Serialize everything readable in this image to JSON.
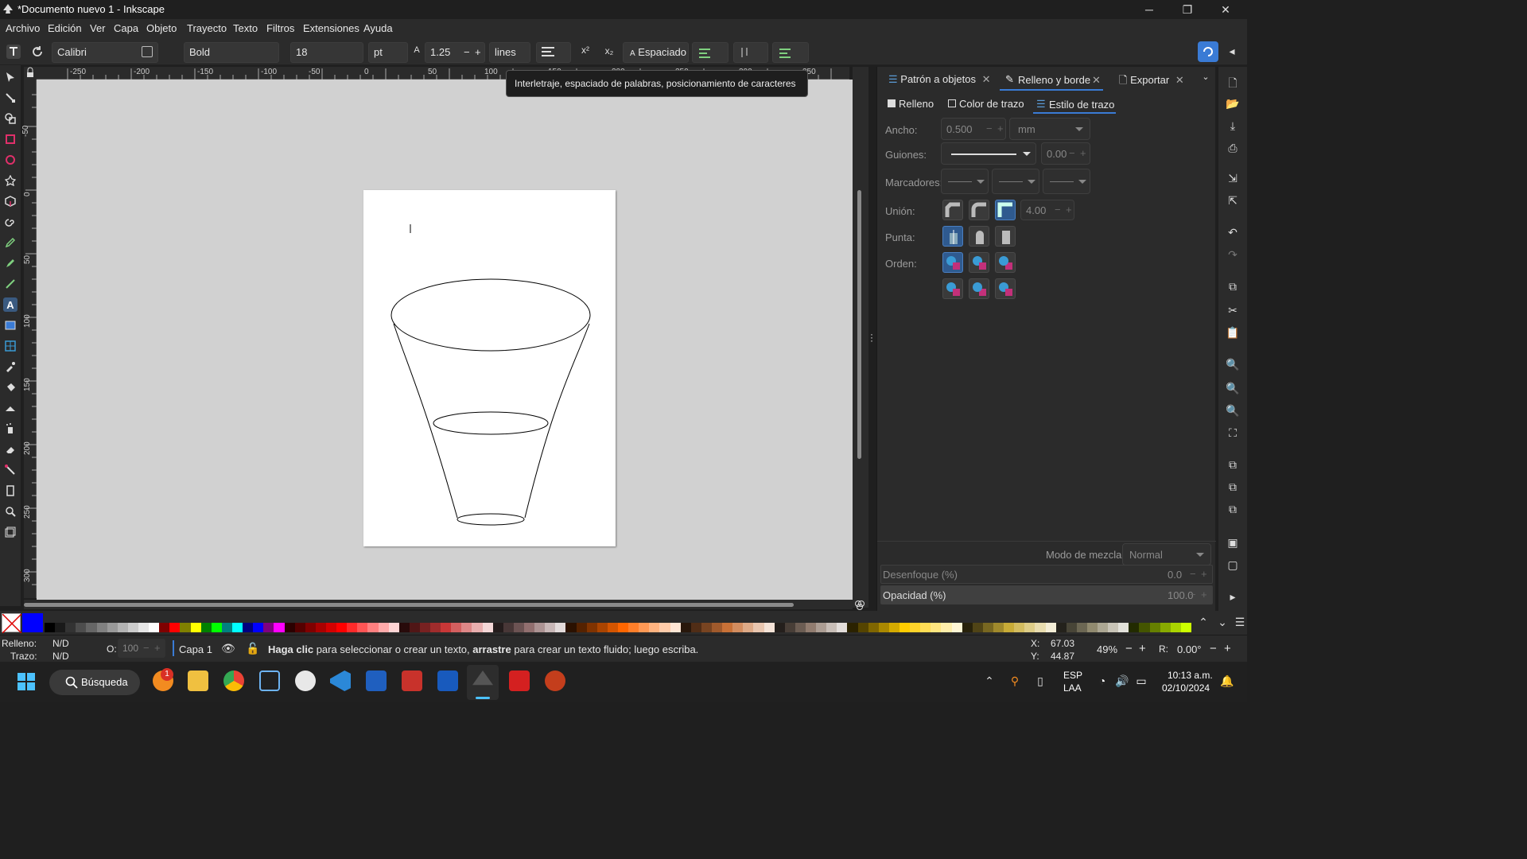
{
  "window": {
    "title": "*Documento nuevo 1 - Inkscape",
    "minimize": "─",
    "maximize": "❐",
    "close": "✕"
  },
  "menu": [
    "Archivo",
    "Edición",
    "Ver",
    "Capa",
    "Objeto",
    "Trayecto",
    "Texto",
    "Filtros",
    "Extensiones",
    "Ayuda"
  ],
  "toolbar": {
    "font_family": "Calibri",
    "font_style": "Bold",
    "font_size": "18",
    "unit": "pt",
    "line_height": "1.25",
    "line_unit": "lines",
    "spacing_label": "Espaciado",
    "minus": "−",
    "plus": "+"
  },
  "tooltip": "Interletraje, espaciado de palabras, posicionamiento de caracteres",
  "ruler": {
    "h": [
      "-250",
      "-200",
      "-150",
      "-100",
      "-50",
      "0",
      "50",
      "100",
      "150",
      "200",
      "250",
      "300",
      "350",
      "400"
    ],
    "v": [
      "-50",
      "0",
      "50",
      "100",
      "150",
      "200",
      "250",
      "300"
    ]
  },
  "dock": {
    "tabs": [
      {
        "label": "Patrón a objetos",
        "close": "✕"
      },
      {
        "label": "Relleno y borde",
        "close": "✕"
      },
      {
        "label": "Exportar",
        "close": "✕"
      }
    ],
    "subtabs": [
      "Relleno",
      "Color de trazo",
      "Estilo de trazo"
    ],
    "width_label": "Ancho:",
    "width_value": "0.500",
    "width_unit": "mm",
    "dash_label": "Guiones:",
    "dash_value": "0.00",
    "markers_label": "Marcadores:",
    "join_label": "Unión:",
    "join_value": "4.00",
    "cap_label": "Punta:",
    "order_label": "Orden:",
    "blend_label": "Modo de mezcla:",
    "blend_value": "Normal",
    "blur_label": "Desenfoque (%)",
    "blur_value": "0.0",
    "opacity_label": "Opacidad (%)",
    "opacity_value": "100.0"
  },
  "status": {
    "fill_label": "Relleno:",
    "fill_value": "N/D",
    "stroke_label": "Trazo:",
    "stroke_value": "N/D",
    "o_label": "O:",
    "o_value": "100",
    "layer": "Capa 1",
    "message_bold1": "Haga clic",
    "message_mid": " para seleccionar o crear un texto, ",
    "message_bold2": "arrastre",
    "message_end": " para crear un texto fluido; luego escriba.",
    "x_label": "X:",
    "x_value": "67.03",
    "y_label": "Y:",
    "y_value": "44.87",
    "zoom": "49%",
    "r_label": "R:",
    "rotation": "0.00°"
  },
  "taskbar": {
    "search": "Búsqueda",
    "badge": "1",
    "lang1": "ESP",
    "lang2": "LAA",
    "time": "10:13 a.m.",
    "date": "02/10/2024"
  },
  "colors": {
    "accent": "#3a7bd5",
    "background": "#2b2b2b",
    "canvas": "#d1d1d1"
  }
}
